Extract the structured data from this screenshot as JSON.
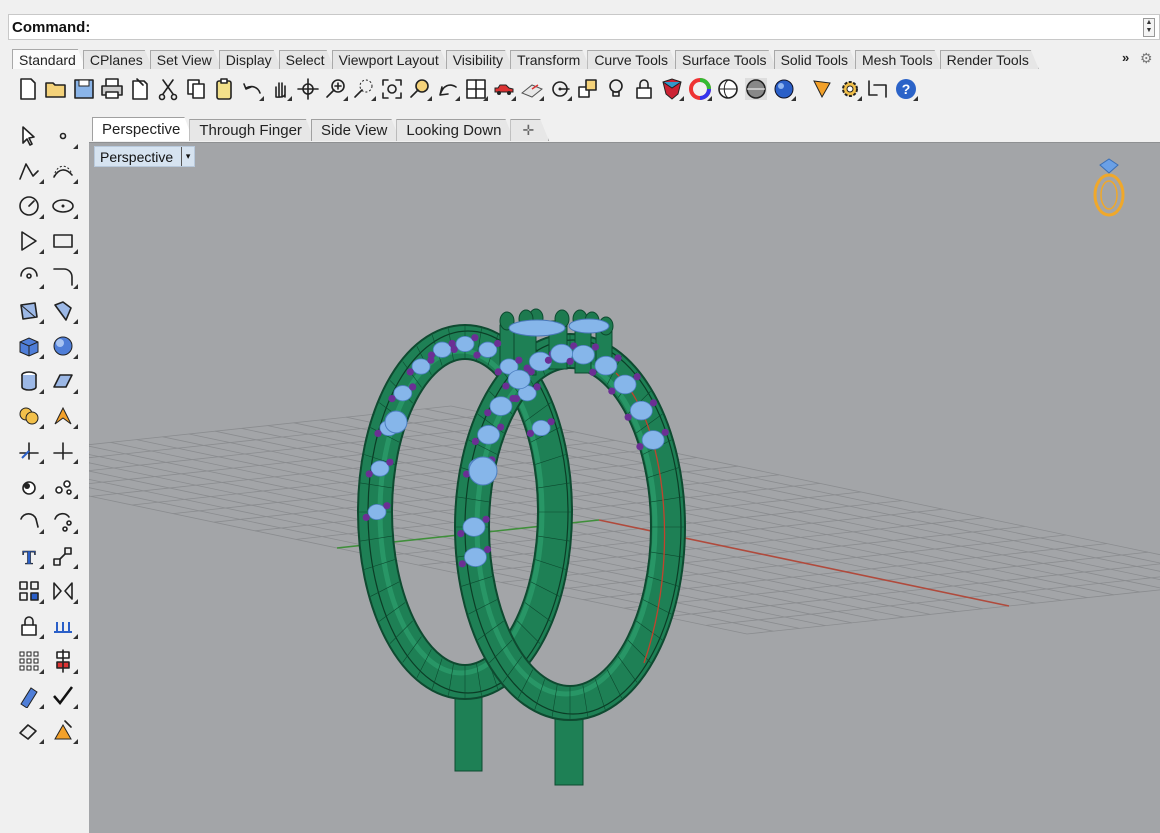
{
  "command": {
    "label": "Command:",
    "value": ""
  },
  "toolbar_tabs": [
    "Standard",
    "CPlanes",
    "Set View",
    "Display",
    "Select",
    "Viewport Layout",
    "Visibility",
    "Transform",
    "Curve Tools",
    "Surface Tools",
    "Solid Tools",
    "Mesh Tools",
    "Render Tools"
  ],
  "toolbar_tabs_active": "Standard",
  "toolbar_overflow_glyph": "»",
  "main_toolbar_icons": [
    "new-file-icon",
    "open-file-icon",
    "save-icon",
    "print-icon",
    "import-icon",
    "cut-icon",
    "copy-icon",
    "paste-icon",
    "undo-icon",
    "pan-hand-icon",
    "rotate-view-icon",
    "zoom-dynamic-icon",
    "zoom-window-icon",
    "zoom-extents-icon",
    "zoom-selected-icon",
    "undo-view-icon",
    "four-viewports-icon",
    "car-icon",
    "cplane-icon",
    "point-snap-icon",
    "layers-icon",
    "lightbulb-icon",
    "lock-icon",
    "render-shield-icon",
    "color-wheel-icon",
    "shaded-sphere-icon",
    "rendered-sphere-icon",
    "blue-sphere-icon",
    "render-cone-icon",
    "gear-options-icon",
    "dimension-icon",
    "help-icon"
  ],
  "left_toolbar_icons": [
    [
      "select-arrow-icon",
      "point-icon"
    ],
    [
      "polyline-icon",
      "curve-icon"
    ],
    [
      "circle-icon",
      "ellipse-icon"
    ],
    [
      "polygon-icon",
      "rectangle-icon"
    ],
    [
      "arc-icon",
      "fillet-curve-icon"
    ],
    [
      "surface-from-points-icon",
      "extrude-surface-icon"
    ],
    [
      "box-solid-icon",
      "sphere-solid-icon"
    ],
    [
      "cylinder-icon",
      "plane-surface-icon"
    ],
    [
      "boolean-union-icon",
      "explode-icon"
    ],
    [
      "trim-icon",
      "split-icon"
    ],
    [
      "group-icon",
      "ungroup-icon"
    ],
    [
      "rotate-icon",
      "array-rotate-icon"
    ],
    [
      "text-icon",
      "scale-icon"
    ],
    [
      "array-icon",
      "mirror-icon"
    ],
    [
      "block-icon",
      "dimension-tool-icon"
    ],
    [
      "grid-array-icon",
      "align-icon"
    ],
    [
      "analyze-icon",
      "check-icon"
    ],
    [
      "render-mesh-icon",
      "light-icon"
    ]
  ],
  "viewport_tabs": [
    "Perspective",
    "Through Finger",
    "Side View",
    "Looking Down"
  ],
  "viewport_tabs_active": "Perspective",
  "viewport": {
    "title": "Perspective",
    "title_arrow": "▾"
  },
  "colors": {
    "ring": "#1e8055",
    "gem": "#86b6ea",
    "prong": "#6b2f94",
    "grid_x_axis": "#b04a3c",
    "grid_y_axis": "#3f8f3a",
    "gizmo": "#f0a82a",
    "viewport_bg": "#a3a5a8"
  }
}
